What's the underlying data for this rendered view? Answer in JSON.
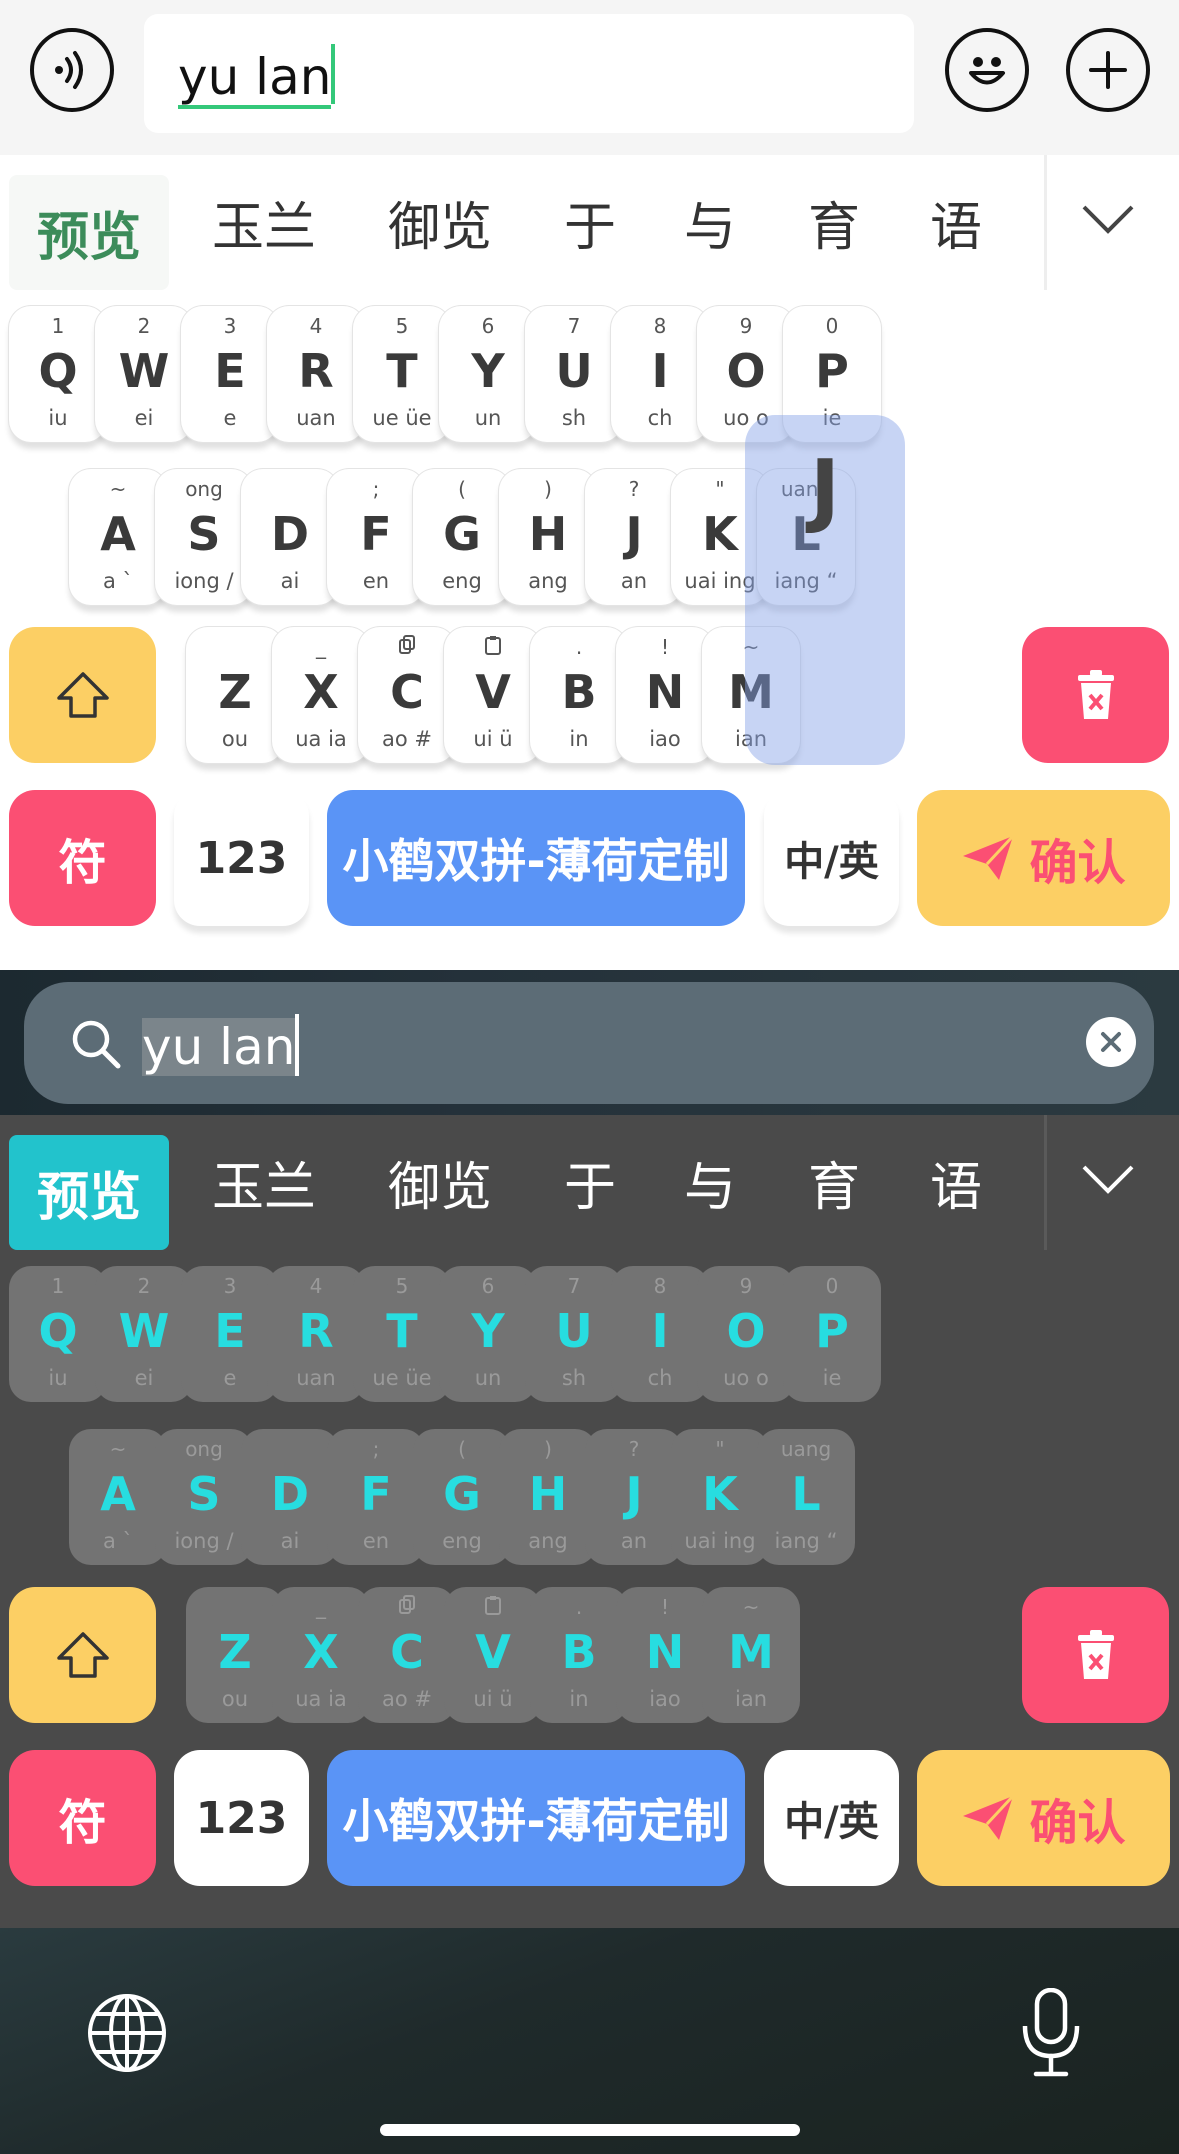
{
  "chat": {
    "input_value": "yu lan",
    "voice_icon": "voice-wave-icon",
    "emoji_icon": "emoji-face-icon",
    "plus_icon": "plus-circle-icon"
  },
  "candidates": [
    "预览",
    "玉兰",
    "御览",
    "于",
    "与",
    "育",
    "语"
  ],
  "keys_row1": [
    {
      "n": "1",
      "m": "Q",
      "s": "iu"
    },
    {
      "n": "2",
      "m": "W",
      "s": "ei"
    },
    {
      "n": "3",
      "m": "E",
      "s": "e"
    },
    {
      "n": "4",
      "m": "R",
      "s": "uan"
    },
    {
      "n": "5",
      "m": "T",
      "s": "ue üe"
    },
    {
      "n": "6",
      "m": "Y",
      "s": "un"
    },
    {
      "n": "7",
      "m": "U",
      "s": "sh"
    },
    {
      "n": "8",
      "m": "I",
      "s": "ch"
    },
    {
      "n": "9",
      "m": "O",
      "s": "uo o"
    },
    {
      "n": "0",
      "m": "P",
      "s": "ie"
    }
  ],
  "keys_row2": [
    {
      "n": "~",
      "m": "A",
      "s": "a `"
    },
    {
      "n": "ong",
      "m": "S",
      "s": "iong /"
    },
    {
      "n": "",
      "m": "D",
      "s": "ai"
    },
    {
      "n": ";",
      "m": "F",
      "s": "en"
    },
    {
      "n": "(",
      "m": "G",
      "s": "eng"
    },
    {
      "n": ")",
      "m": "H",
      "s": "ang"
    },
    {
      "n": "?",
      "m": "J",
      "s": "an"
    },
    {
      "n": "\"",
      "m": "K",
      "s": "uai ing"
    },
    {
      "n": "uang",
      "m": "L",
      "s": "iang “"
    }
  ],
  "keys_row3": [
    {
      "n": "",
      "m": "Z",
      "s": "ou"
    },
    {
      "n": "_",
      "m": "X",
      "s": "ua ia"
    },
    {
      "n": "copy",
      "m": "C",
      "s": "ao #"
    },
    {
      "n": "paste",
      "m": "V",
      "s": "ui ü"
    },
    {
      "n": ".",
      "m": "B",
      "s": "in"
    },
    {
      "n": "!",
      "m": "N",
      "s": "iao"
    },
    {
      "n": "~",
      "m": "M",
      "s": "ian"
    }
  ],
  "function_keys": {
    "symbol": "符",
    "numbers": "123",
    "space": "小鹤双拼-薄荷定制",
    "lang_switch": "中/英",
    "confirm": "确认"
  },
  "popup_key": "J",
  "search": {
    "value": "yu lan"
  },
  "colors": {
    "accent_green": "#34c87a",
    "candidate_highlight_dark": "#22c3cc",
    "key_letter_dark": "#27dde0",
    "shift_yellow": "#fccf64",
    "delete_pink": "#fb4f73",
    "space_blue": "#5a94f6"
  }
}
